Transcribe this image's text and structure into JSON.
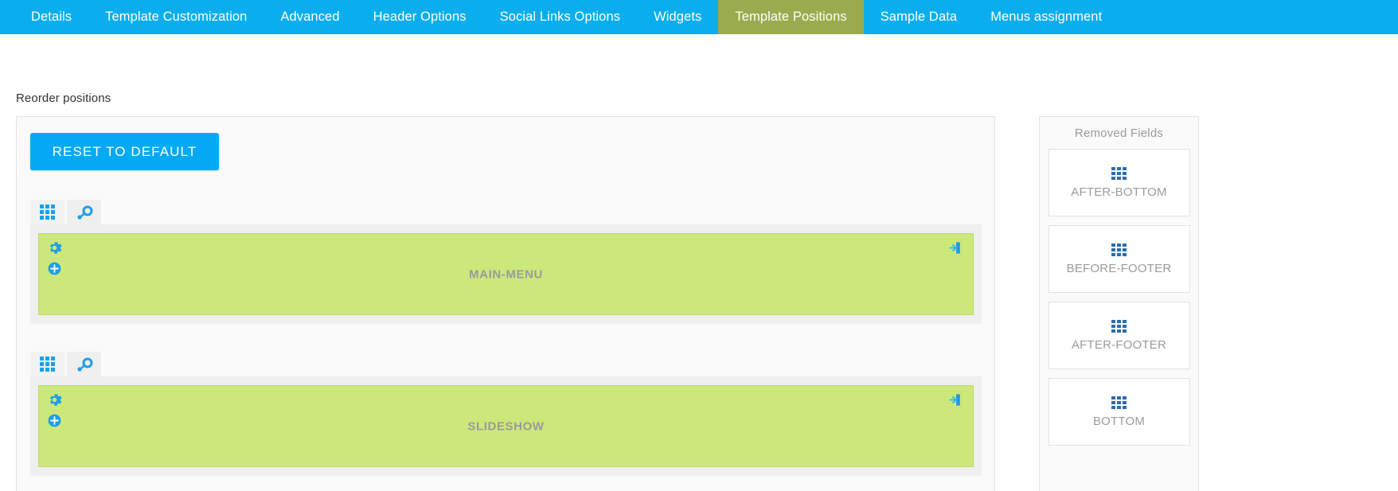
{
  "nav": {
    "tabs": [
      {
        "label": "Details",
        "active": false
      },
      {
        "label": "Template Customization",
        "active": false
      },
      {
        "label": "Advanced",
        "active": false
      },
      {
        "label": "Header Options",
        "active": false
      },
      {
        "label": "Social Links Options",
        "active": false
      },
      {
        "label": "Widgets",
        "active": false
      },
      {
        "label": "Template Positions",
        "active": true
      },
      {
        "label": "Sample Data",
        "active": false
      },
      {
        "label": "Menus assignment",
        "active": false
      }
    ],
    "active_bg": "#9aab4e",
    "bar_bg": "#0aaeef"
  },
  "main": {
    "reorder_label": "Reorder positions",
    "reset_button": "RESET TO DEFAULT",
    "panel_bg": "#fafafa",
    "row_bg": "#efefef",
    "position_color": "#cde87a",
    "positions": [
      {
        "name": "MAIN-MENU",
        "tabs": [
          {
            "icon": "grid-icon",
            "active": true
          },
          {
            "icon": "key-icon",
            "active": false
          }
        ],
        "actions": [
          "gear-icon",
          "plus-circle-icon",
          "exit-icon"
        ]
      },
      {
        "name": "SLIDESHOW",
        "tabs": [
          {
            "icon": "grid-icon",
            "active": true
          },
          {
            "icon": "key-icon",
            "active": false
          }
        ],
        "actions": [
          "gear-icon",
          "plus-circle-icon",
          "exit-icon"
        ]
      }
    ]
  },
  "removed": {
    "title": "Removed Fields",
    "cards": [
      {
        "label": "AFTER-BOTTOM",
        "icon": "grid-icon"
      },
      {
        "label": "BEFORE-FOOTER",
        "icon": "grid-icon"
      },
      {
        "label": "AFTER-FOOTER",
        "icon": "grid-icon"
      },
      {
        "label": "BOTTOM",
        "icon": "grid-icon"
      }
    ]
  }
}
